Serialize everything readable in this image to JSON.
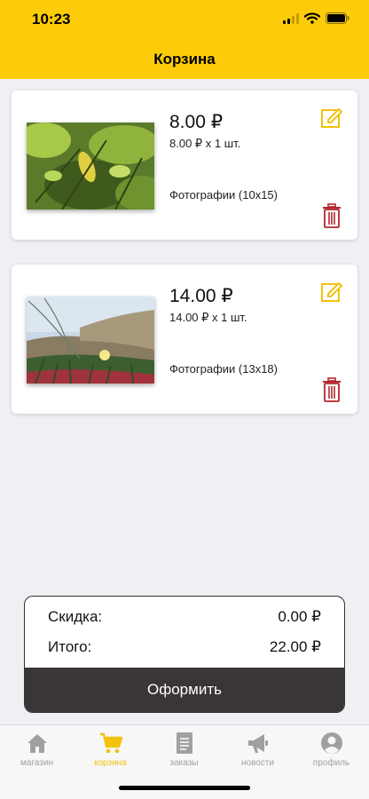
{
  "status_bar": {
    "time": "10:23"
  },
  "header": {
    "title": "Корзина"
  },
  "cart_items": [
    {
      "price": "8.00 ₽",
      "quantity": "8.00 ₽ x 1 шт.",
      "product": "Фотографии (10x15)",
      "edit_icon": "edit-icon",
      "delete_icon": "trash-icon"
    },
    {
      "price": "14.00 ₽",
      "quantity": "14.00 ₽ x 1 шт.",
      "product": "Фотографии (13x18)",
      "edit_icon": "edit-icon",
      "delete_icon": "trash-icon"
    }
  ],
  "summary": {
    "discount_label": "Скидка:",
    "discount_value": "0.00 ₽",
    "total_label": "Итого:",
    "total_value": "22.00 ₽",
    "checkout_label": "Оформить"
  },
  "tabs": [
    {
      "label": "магазин",
      "icon": "home-icon",
      "active": false
    },
    {
      "label": "корзина",
      "icon": "cart-icon",
      "active": true
    },
    {
      "label": "заказы",
      "icon": "document-icon",
      "active": false
    },
    {
      "label": "новости",
      "icon": "megaphone-icon",
      "active": false
    },
    {
      "label": "профиль",
      "icon": "profile-icon",
      "active": false
    }
  ],
  "colors": {
    "accent": "#fccc0a",
    "edit_icon": "#f2c20e",
    "delete_icon": "#b3262e",
    "checkout_bg": "#3a3537",
    "tab_inactive": "#a0a0a0"
  }
}
